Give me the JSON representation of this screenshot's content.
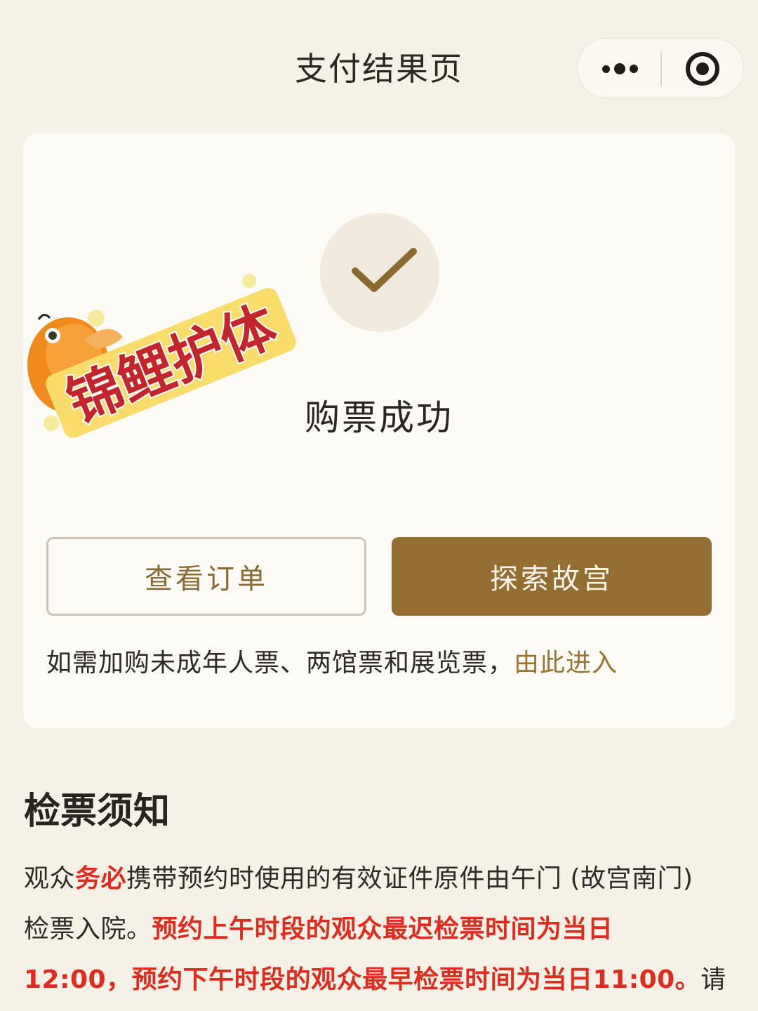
{
  "header": {
    "title": "支付结果页",
    "more_icon": "more-dots-icon",
    "close_icon": "target-close-icon"
  },
  "result": {
    "status_icon": "check-icon",
    "message": "购票成功"
  },
  "actions": {
    "view_order": "查看订单",
    "explore": "探索故宫"
  },
  "extra": {
    "text": "如需加购未成年人票、两馆票和展览票，",
    "link": "由此进入"
  },
  "notice": {
    "title": "检票须知",
    "line1": {
      "a": "观众",
      "b": "务必",
      "c": "携带预约时使用的有效证件原件由午门 (故宫南门)"
    },
    "line2": {
      "a": "检票入院。",
      "b": "预约上午时段的观众最迟检票时间为当日"
    },
    "line3": {
      "a": "12:00，预约下午时段的观众最早检票时间为当日11:00。",
      "b": "请"
    }
  },
  "sticker": {
    "text": "锦鲤护体",
    "icon": "koi-fish-icon"
  },
  "colors": {
    "background": "#f6f1e6",
    "card": "#fdfbf6",
    "accent": "#946d32",
    "link": "#9a7534",
    "highlight": "#e02b1f"
  }
}
